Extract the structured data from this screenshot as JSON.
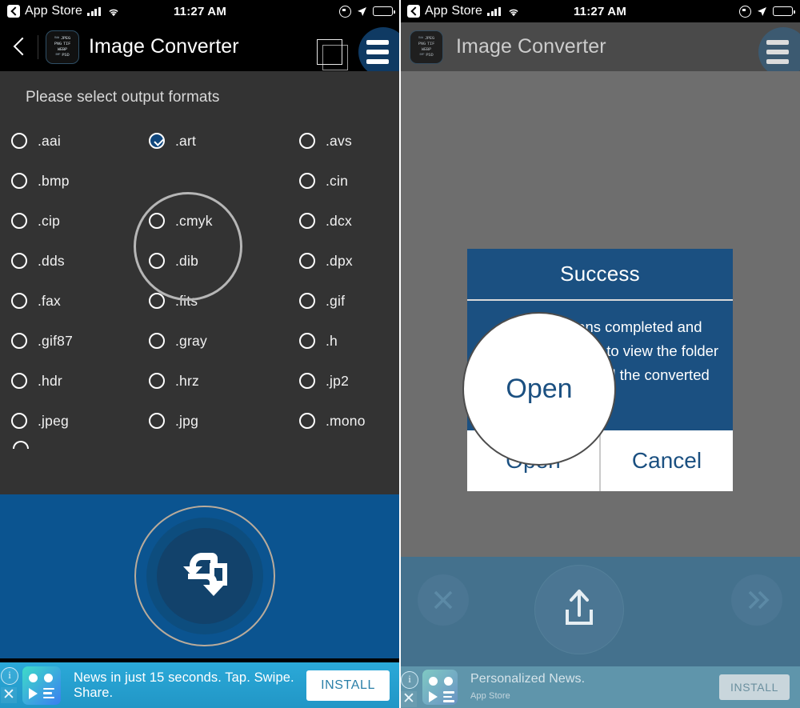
{
  "status_bar": {
    "back_label": "App Store",
    "time": "11:27 AM",
    "icons": [
      "back-chevron-icon",
      "cellular-signal-icon",
      "wifi-icon",
      "rotation-lock-icon",
      "location-arrow-icon",
      "battery-icon"
    ]
  },
  "app": {
    "title": "Image Converter",
    "icon_rows": [
      [
        "RAW",
        "JPEG"
      ],
      [
        "PNG",
        "TIF"
      ],
      [
        "WEBP"
      ],
      [
        "BMP",
        "PSD"
      ]
    ],
    "back_icon": "back-chevron-icon",
    "stack_icon": "copy-stack-icon",
    "menu_icon": "hamburger-menu-icon"
  },
  "left_screen": {
    "prompt": "Please select output formats",
    "rows": [
      [
        {
          "label": ".aai",
          "selected": false
        },
        {
          "label": ".art",
          "selected": true
        },
        {
          "label": ".avs",
          "selected": false
        }
      ],
      [
        {
          "label": ".bmp",
          "selected": false
        },
        {
          "label": "",
          "selected": null
        },
        {
          "label": ".cin",
          "selected": false
        }
      ],
      [
        {
          "label": ".cip",
          "selected": false
        },
        {
          "label": ".cmyk",
          "selected": false
        },
        {
          "label": ".dcx",
          "selected": false
        }
      ],
      [
        {
          "label": ".dds",
          "selected": false
        },
        {
          "label": ".dib",
          "selected": false
        },
        {
          "label": ".dpx",
          "selected": false
        }
      ],
      [
        {
          "label": ".fax",
          "selected": false
        },
        {
          "label": ".fits",
          "selected": false
        },
        {
          "label": ".gif",
          "selected": false
        }
      ],
      [
        {
          "label": ".gif87",
          "selected": false
        },
        {
          "label": ".gray",
          "selected": false
        },
        {
          "label": ".h",
          "selected": false
        }
      ],
      [
        {
          "label": ".hdr",
          "selected": false
        },
        {
          "label": ".hrz",
          "selected": false
        },
        {
          "label": ".jp2",
          "selected": false
        }
      ],
      [
        {
          "label": ".jpeg",
          "selected": false
        },
        {
          "label": ".jpg",
          "selected": false
        },
        {
          "label": ".mono",
          "selected": false
        }
      ]
    ],
    "convert_icon": "convert-swap-arrow-icon",
    "highlight": "art-option-highlight-circle",
    "ad": {
      "headline": "News in just 15 seconds. Tap. Swipe. Share.",
      "install_label": "INSTALL",
      "info_icon": "ad-info-icon",
      "close_icon": "ad-close-icon",
      "app_icon": "news-app-icon"
    }
  },
  "right_screen": {
    "dialog": {
      "title": "Success",
      "message": "All Conversions completed and saved, press open to view the folder in which you saved the converted files",
      "open_label": "Open",
      "cancel_label": "Cancel"
    },
    "highlight": "open-button-highlight-circle",
    "toolbar": {
      "cancel_icon": "x-close-icon",
      "share_icon": "share-upload-icon",
      "next_icon": "double-chevron-right-icon"
    },
    "ad": {
      "headline": "Personalized News.",
      "source": "App Store",
      "install_label": "INSTALL",
      "info_icon": "ad-info-icon",
      "close_icon": "ad-close-icon",
      "app_icon": "news-app-icon"
    }
  },
  "colors": {
    "brand_blue": "#0b5490",
    "dialog_blue": "#1b5081",
    "list_bg": "#333333",
    "ad_cyan": "#2ba9d8",
    "dim_gray": "#6e6e6e"
  }
}
